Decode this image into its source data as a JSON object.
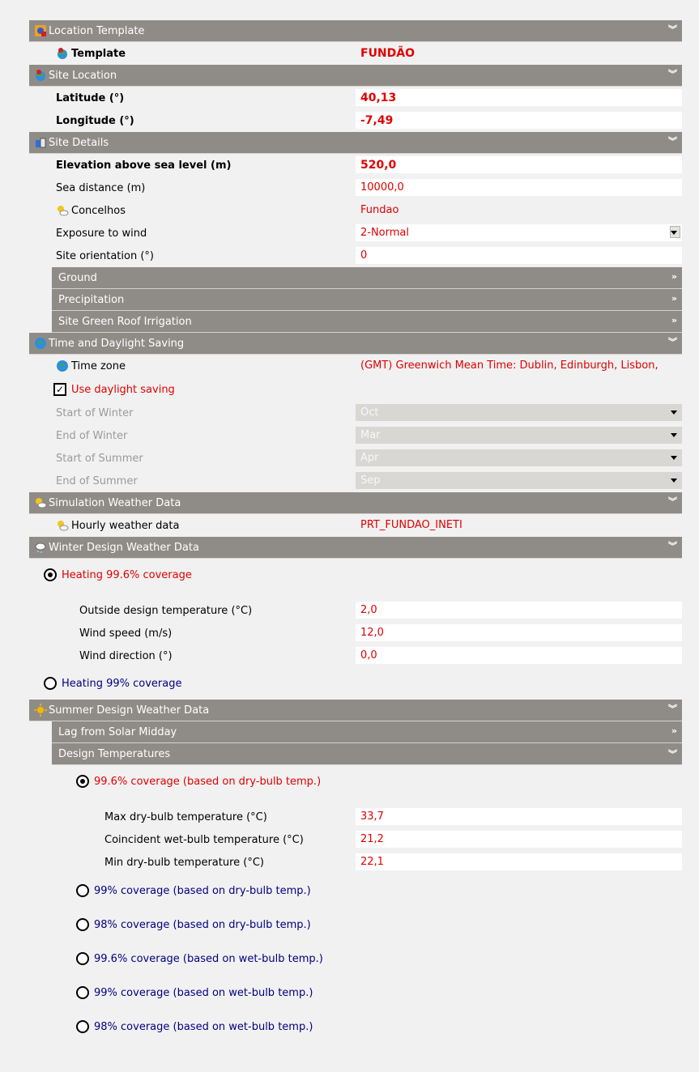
{
  "location_template": {
    "header": "Location Template",
    "template_label": "Template",
    "template_value": "FUNDÃO"
  },
  "site_location": {
    "header": "Site Location",
    "latitude_label": "Latitude (°)",
    "latitude_value": "40,13",
    "longitude_label": "Longitude (°)",
    "longitude_value": "-7,49"
  },
  "site_details": {
    "header": "Site Details",
    "elevation_label": "Elevation above sea level (m)",
    "elevation_value": "520,0",
    "sea_distance_label": "Sea distance (m)",
    "sea_distance_value": "10000,0",
    "concelhos_label": "Concelhos",
    "concelhos_value": "Fundao",
    "exposure_label": "Exposure to wind",
    "exposure_value": "2-Normal",
    "orientation_label": "Site orientation (°)",
    "orientation_value": "0",
    "subsections": [
      "Ground",
      "Precipitation",
      "Site Green Roof Irrigation"
    ]
  },
  "time_daylight": {
    "header": "Time and Daylight Saving",
    "timezone_label": "Time zone",
    "timezone_value": "(GMT) Greenwich Mean Time: Dublin, Edinburgh, Lisbon,",
    "daylight_label": "Use daylight saving",
    "start_winter_label": "Start of Winter",
    "start_winter_value": "Oct",
    "end_winter_label": "End of Winter",
    "end_winter_value": "Mar",
    "start_summer_label": "Start of Summer",
    "start_summer_value": "Apr",
    "end_summer_label": "End of Summer",
    "end_summer_value": "Sep"
  },
  "sim_weather": {
    "header": "Simulation Weather Data",
    "hourly_label": "Hourly weather data",
    "hourly_value": "PRT_FUNDAO_INETI"
  },
  "winter_design": {
    "header": "Winter Design Weather Data",
    "heating_996_label": "Heating 99.6% coverage",
    "outside_temp_label": "Outside design temperature (°C)",
    "outside_temp_value": "2,0",
    "wind_speed_label": "Wind speed (m/s)",
    "wind_speed_value": "12,0",
    "wind_direction_label": "Wind direction (°)",
    "wind_direction_value": "0,0",
    "heating_99_label": "Heating 99% coverage"
  },
  "summer_design": {
    "header": "Summer Design Weather Data",
    "lag_header": "Lag from Solar Midday",
    "design_temps_header": "Design Temperatures",
    "opt_996_db": "99.6% coverage (based on dry-bulb temp.)",
    "max_db_label": "Max dry-bulb temperature (°C)",
    "max_db_value": "33,7",
    "coinc_wb_label": "Coincident wet-bulb temperature (°C)",
    "coinc_wb_value": "21,2",
    "min_db_label": "Min dry-bulb temperature (°C)",
    "min_db_value": "22,1",
    "opt_99_db": "99% coverage (based on dry-bulb temp.)",
    "opt_98_db": "98% coverage (based on dry-bulb temp.)",
    "opt_996_wb": "99.6% coverage (based on wet-bulb temp.)",
    "opt_99_wb": "99% coverage (based on wet-bulb temp.)",
    "opt_98_wb": "98% coverage (based on wet-bulb temp.)"
  },
  "icons": {
    "expanded": "double-chevron-down-icon",
    "collapsed": "double-chevron-right-icon"
  }
}
